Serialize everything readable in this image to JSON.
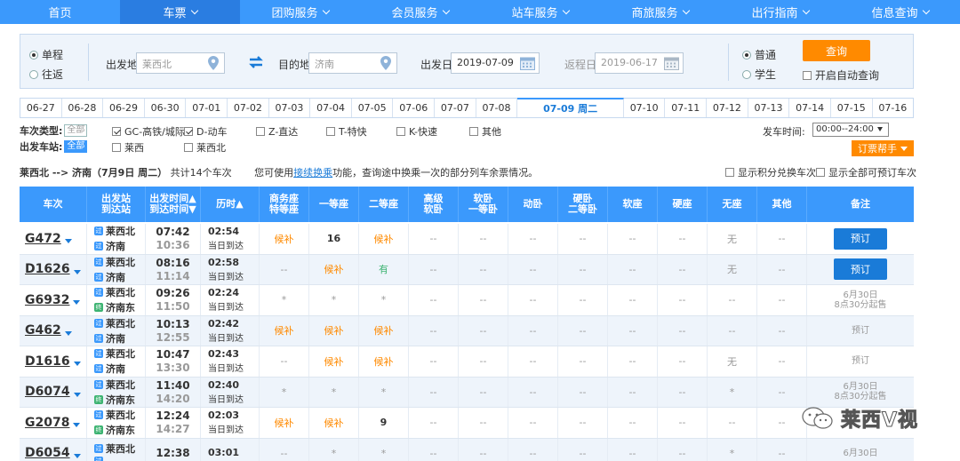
{
  "nav": [
    {
      "label": "首页",
      "dropdown": false
    },
    {
      "label": "车票",
      "dropdown": true,
      "active": true
    },
    {
      "label": "团购服务",
      "dropdown": true
    },
    {
      "label": "会员服务",
      "dropdown": true
    },
    {
      "label": "站车服务",
      "dropdown": true
    },
    {
      "label": "商旅服务",
      "dropdown": true
    },
    {
      "label": "出行指南",
      "dropdown": true
    },
    {
      "label": "信息查询",
      "dropdown": true
    }
  ],
  "search": {
    "trip_oneway": "单程",
    "trip_round": "往返",
    "from_label": "出发地",
    "from_value": "莱西北",
    "to_label": "目的地",
    "to_value": "济南",
    "depart_label": "出发日",
    "depart_value": "2019-07-09",
    "return_label": "返程日",
    "return_value": "2019-06-17",
    "type_normal": "普通",
    "type_student": "学生",
    "query_label": "查询",
    "auto_query_label": "开启自动查询"
  },
  "dates": [
    "06-27",
    "06-28",
    "06-29",
    "06-30",
    "07-01",
    "07-02",
    "07-03",
    "07-04",
    "07-05",
    "07-06",
    "07-07",
    "07-08",
    "07-09 周二",
    "07-10",
    "07-11",
    "07-12",
    "07-13",
    "07-14",
    "07-15",
    "07-16"
  ],
  "filters": {
    "train_type_label": "车次类型:",
    "all_label": "全部",
    "types": [
      "GC-高铁/城际",
      "D-动车",
      "Z-直达",
      "T-特快",
      "K-快速",
      "其他"
    ],
    "station_label": "出发车站:",
    "stations": [
      "莱西",
      "莱西北"
    ],
    "time_label": "发车时间:",
    "time_value": "00:00--24:00",
    "helper_label": "订票帮手"
  },
  "summary": {
    "route": "莱西北 --> 济南（7月9日 周二）",
    "count": "共计14个车次",
    "hint_pre": "您可使用",
    "hint_link": "接续换乘",
    "hint_post": "功能，查询途中换乘一次的部分列车余票情况。",
    "opt_points": "显示积分兑换车次",
    "opt_all": "显示全部可预订车次"
  },
  "headers": {
    "train": "车次",
    "stations": "出发站\n到达站",
    "times": "出发时间▲\n到达时间▼",
    "duration": "历时▲",
    "business": "商务座\n特等座",
    "first": "一等座",
    "second": "二等座",
    "adv_sleeper": "高级\n软卧",
    "soft_sleeper": "软卧\n一等卧",
    "moving": "动卧",
    "hard_sleeper": "硬卧\n二等卧",
    "soft_seat": "软座",
    "hard_seat": "硬座",
    "no_seat": "无座",
    "other": "其他",
    "note": "备注"
  },
  "trains": [
    {
      "no": "G472",
      "from": "莱西北",
      "to": "济南",
      "to_badge": "pass",
      "dep": "07:42",
      "arr": "10:36",
      "dur": "02:54",
      "day": "当日到达",
      "seats": [
        "候补",
        "16",
        "候补",
        "--",
        "--",
        "--",
        "--",
        "--",
        "--",
        "无",
        "--"
      ],
      "note": "预订",
      "book": true
    },
    {
      "no": "D1626",
      "from": "莱西北",
      "to": "济南",
      "to_badge": "pass",
      "dep": "08:16",
      "arr": "11:14",
      "dur": "02:58",
      "day": "当日到达",
      "seats": [
        "--",
        "候补",
        "有",
        "--",
        "--",
        "--",
        "--",
        "--",
        "--",
        "无",
        "--"
      ],
      "note": "预订",
      "book": true
    },
    {
      "no": "G6932",
      "from": "莱西北",
      "to": "济南东",
      "to_badge": "end",
      "dep": "09:26",
      "arr": "11:50",
      "dur": "02:24",
      "day": "当日到达",
      "seats": [
        "*",
        "*",
        "*",
        "--",
        "--",
        "--",
        "--",
        "--",
        "--",
        "--",
        "--"
      ],
      "note": "6月30日\n8点30分起售",
      "book": false
    },
    {
      "no": "G462",
      "from": "莱西北",
      "to": "济南",
      "to_badge": "pass",
      "dep": "10:13",
      "arr": "12:55",
      "dur": "02:42",
      "day": "当日到达",
      "seats": [
        "候补",
        "候补",
        "候补",
        "--",
        "--",
        "--",
        "--",
        "--",
        "--",
        "--",
        "--"
      ],
      "note": "预订",
      "book": false
    },
    {
      "no": "D1616",
      "from": "莱西北",
      "to": "济南",
      "to_badge": "pass",
      "dep": "10:47",
      "arr": "13:30",
      "dur": "02:43",
      "day": "当日到达",
      "seats": [
        "--",
        "候补",
        "候补",
        "--",
        "--",
        "--",
        "--",
        "--",
        "--",
        "无",
        "--"
      ],
      "note": "预订",
      "book": false
    },
    {
      "no": "D6074",
      "from": "莱西北",
      "to": "济南东",
      "to_badge": "end",
      "dep": "11:40",
      "arr": "14:20",
      "dur": "02:40",
      "day": "当日到达",
      "seats": [
        "*",
        "*",
        "*",
        "--",
        "--",
        "--",
        "--",
        "--",
        "--",
        "*",
        "--"
      ],
      "note": "6月30日\n8点30分起售",
      "book": false
    },
    {
      "no": "G2078",
      "from": "莱西北",
      "to": "济南东",
      "to_badge": "end",
      "dep": "12:24",
      "arr": "14:27",
      "dur": "02:03",
      "day": "当日到达",
      "seats": [
        "候补",
        "候补",
        "9",
        "--",
        "--",
        "--",
        "--",
        "--",
        "--",
        "--",
        "--"
      ],
      "note": "",
      "book": false
    },
    {
      "no": "D6054",
      "from": "莱西北",
      "to": "",
      "to_badge": "pass",
      "dep": "12:38",
      "arr": "",
      "dur": "03:01",
      "day": "",
      "seats": [
        "--",
        "*",
        "*",
        "--",
        "--",
        "--",
        "--",
        "--",
        "--",
        "*",
        "--"
      ],
      "note": "6月30日",
      "book": false
    }
  ],
  "watermark": "莱西V视"
}
